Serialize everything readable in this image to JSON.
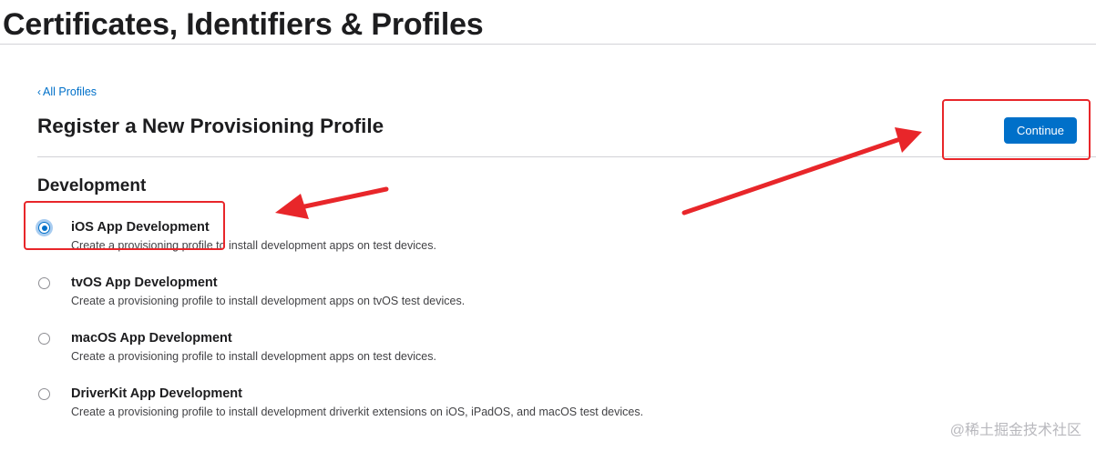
{
  "page_title": "Certificates, Identifiers & Profiles",
  "back_link": {
    "chevron": "‹",
    "label": "All Profiles"
  },
  "header": {
    "title": "Register a New Provisioning Profile",
    "continue_label": "Continue"
  },
  "section": {
    "title": "Development"
  },
  "options": [
    {
      "label": "iOS App Development",
      "description": "Create a provisioning profile to install development apps on test devices.",
      "selected": true
    },
    {
      "label": "tvOS App Development",
      "description": "Create a provisioning profile to install development apps on tvOS test devices.",
      "selected": false
    },
    {
      "label": "macOS App Development",
      "description": "Create a provisioning profile to install development apps on test devices.",
      "selected": false
    },
    {
      "label": "DriverKit App Development",
      "description": "Create a provisioning profile to install development driverkit extensions on iOS, iPadOS, and macOS test devices.",
      "selected": false
    }
  ],
  "annotation_color": "#e8262a",
  "accent_color": "#0070c9",
  "watermark": "@稀土掘金技术社区"
}
